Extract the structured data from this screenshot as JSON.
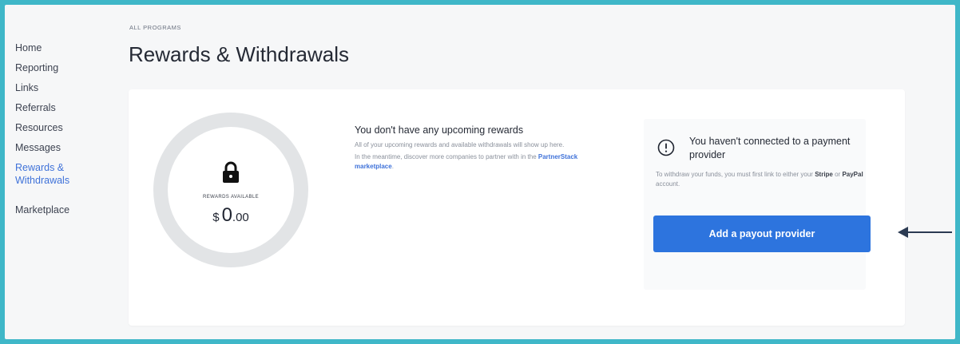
{
  "sidebar": {
    "items": [
      {
        "label": "Home"
      },
      {
        "label": "Reporting"
      },
      {
        "label": "Links"
      },
      {
        "label": "Referrals"
      },
      {
        "label": "Resources"
      },
      {
        "label": "Messages"
      },
      {
        "label": "Rewards & Withdrawals",
        "active": true
      },
      {
        "label": "Marketplace"
      }
    ]
  },
  "header": {
    "breadcrumb": "ALL PROGRAMS",
    "title": "Rewards & Withdrawals"
  },
  "rewards": {
    "lock_icon": "lock-icon",
    "label": "REWARDS AVAILABLE",
    "currency": "$",
    "amount_whole": "0",
    "amount_cents": ".00"
  },
  "upcoming": {
    "title": "You don't have any upcoming rewards",
    "text1": "All of your upcoming rewards and available withdrawals will show up here.",
    "text2_prefix": "In the meantime, discover more companies to partner with in the ",
    "link": "PartnerStack marketplace",
    "text2_suffix": "."
  },
  "payout": {
    "alert_icon": "alert-circle-icon",
    "title": "You haven't connected to a payment provider",
    "text_prefix": "To withdraw your funds, you must first link to either your ",
    "stripe": "Stripe",
    "or": " or ",
    "paypal": "PayPal",
    "text_suffix": " account.",
    "button": "Add a payout provider"
  },
  "colors": {
    "accent": "#2d74de",
    "link": "#3f72d9",
    "background_border": "#3fb7c8"
  }
}
